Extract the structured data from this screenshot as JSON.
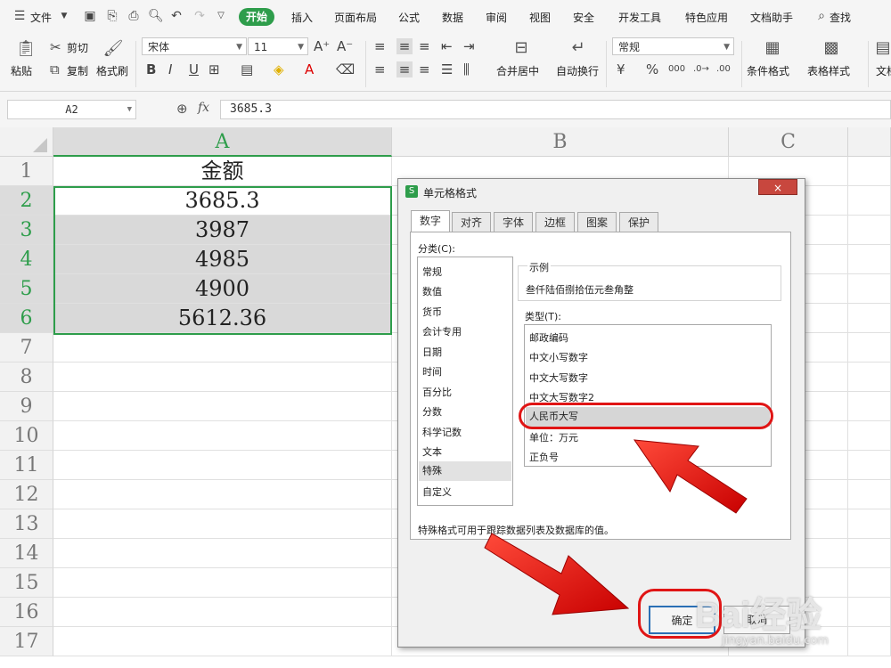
{
  "menubar": {
    "file": "文件",
    "tabs": [
      "开始",
      "插入",
      "页面布局",
      "公式",
      "数据",
      "审阅",
      "视图",
      "安全",
      "开发工具",
      "特色应用",
      "文档助手"
    ],
    "search": "查找"
  },
  "ribbon": {
    "paste": "粘贴",
    "cut": "剪切",
    "copy": "复制",
    "format_painter": "格式刷",
    "font_name": "宋体",
    "font_size": "11",
    "merge_center": "合并居中",
    "wrap_text": "自动换行",
    "number_format": "常规",
    "cond_format": "条件格式",
    "table_style": "表格样式",
    "doc": "文档"
  },
  "formula_bar": {
    "name_box": "A2",
    "fx": "fx",
    "value": "3685.3"
  },
  "sheet": {
    "columns": [
      "A",
      "B",
      "C"
    ],
    "rows": [
      "1",
      "2",
      "3",
      "4",
      "5",
      "6",
      "7",
      "8",
      "9",
      "10",
      "11",
      "12",
      "13",
      "14",
      "15",
      "16",
      "17"
    ],
    "cells": [
      "金额",
      "3685.3",
      "3987",
      "4985",
      "4900",
      "5612.36"
    ]
  },
  "dialog": {
    "title": "单元格格式",
    "close": "×",
    "tabs": [
      "数字",
      "对齐",
      "字体",
      "边框",
      "图案",
      "保护"
    ],
    "category_label": "分类(C):",
    "categories": [
      "常规",
      "数值",
      "货币",
      "会计专用",
      "日期",
      "时间",
      "百分比",
      "分数",
      "科学记数",
      "文本",
      "特殊",
      "自定义"
    ],
    "sample_label": "示例",
    "sample_value": "叁仟陆佰捌拾伍元叁角整",
    "type_label": "类型(T):",
    "types": [
      "邮政编码",
      "中文小写数字",
      "中文大写数字",
      "中文大写数字2",
      "人民币大写",
      "单位：万元",
      "正负号"
    ],
    "description": "特殊格式可用于跟踪数据列表及数据库的值。",
    "ok": "确定",
    "cancel": "取消"
  },
  "watermark": {
    "brand": "Bai经验",
    "url": "jingyan.baidu.com"
  },
  "colors": {
    "accent": "#2e9d4b",
    "annotation": "#e01515"
  }
}
